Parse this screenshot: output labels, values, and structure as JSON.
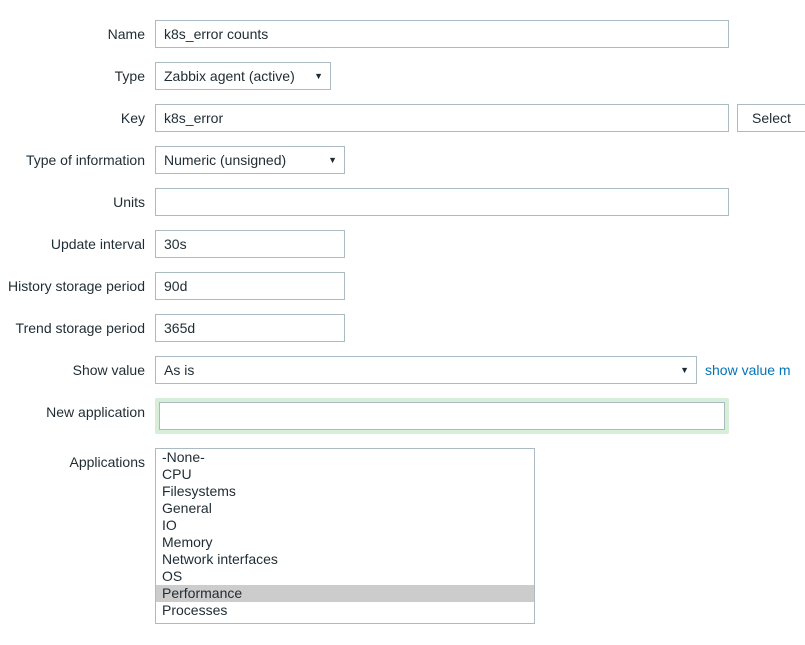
{
  "labels": {
    "name": "Name",
    "type": "Type",
    "key": "Key",
    "type_of_information": "Type of information",
    "units": "Units",
    "update_interval": "Update interval",
    "history_storage_period": "History storage period",
    "trend_storage_period": "Trend storage period",
    "show_value": "Show value",
    "new_application": "New application",
    "applications": "Applications"
  },
  "values": {
    "name": "k8s_error counts",
    "type": "Zabbix agent (active)",
    "key": "k8s_error",
    "type_of_information": "Numeric (unsigned)",
    "units": "",
    "update_interval": "30s",
    "history_storage_period": "90d",
    "trend_storage_period": "365d",
    "show_value": "As is",
    "new_application": ""
  },
  "buttons": {
    "select": "Select"
  },
  "links": {
    "show_value_mappings": "show value m"
  },
  "applications": {
    "items": [
      "-None-",
      "CPU",
      "Filesystems",
      "General",
      "IO",
      "Memory",
      "Network interfaces",
      "OS",
      "Performance",
      "Processes"
    ],
    "selected_index": 8
  }
}
